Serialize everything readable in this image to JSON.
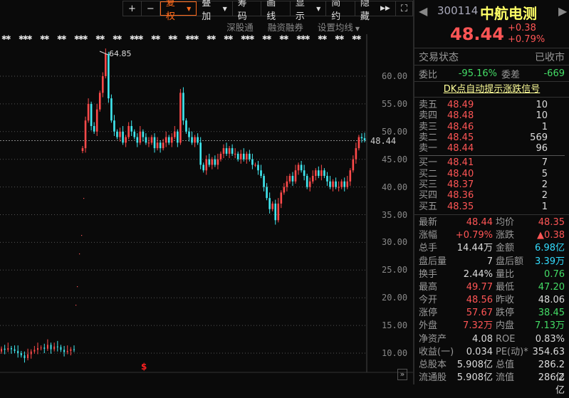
{
  "toolbar": {
    "plus": "+",
    "minus": "−",
    "fuquan": "复权",
    "diejia": "叠加",
    "chouma": "筹码",
    "huaxian": "画线",
    "xianshi": "显示",
    "jianyue": "简约",
    "yincang": "隐藏",
    "fullscreen": "⛶"
  },
  "subbar": [
    "深股通",
    "融资融券",
    "设置均线"
  ],
  "axis": [
    "60.00",
    "55.00",
    "50.00",
    "45.00",
    "40.00",
    "35.00",
    "30.00",
    "25.00",
    "20.00",
    "15.00",
    "10.00"
  ],
  "current_price_tag": "48.44",
  "peak_label": "64.85",
  "colors": {
    "up": "#ff4a4a",
    "down": "#40e8f0",
    "accent": "#ff6a1a"
  },
  "chart_data": {
    "type": "candlestick",
    "ylim": [
      10,
      60
    ],
    "closes": [
      47,
      52,
      55,
      51,
      50,
      54,
      57,
      60,
      64,
      56,
      52,
      50,
      49,
      50,
      48,
      49,
      51,
      50,
      49,
      48,
      50,
      49,
      48,
      48,
      49,
      47,
      48,
      47,
      48,
      49,
      48,
      49,
      50,
      48,
      57,
      52,
      50,
      49,
      48,
      49,
      48,
      44,
      43,
      45,
      44,
      45,
      44,
      45,
      46,
      47,
      46,
      47,
      46,
      46,
      45,
      46,
      45,
      46,
      45,
      44,
      44,
      43,
      42,
      40,
      38,
      36,
      37,
      34,
      37,
      39,
      40,
      41,
      42,
      41,
      43,
      44,
      43,
      42,
      40,
      41,
      42,
      43,
      42,
      43,
      42,
      41,
      40,
      41,
      40,
      40,
      41,
      40,
      41,
      43,
      45,
      47,
      49,
      48.8,
      48.44
    ],
    "early_closes": [
      10.8,
      10.6,
      10.9,
      10.7,
      10.4,
      10.0,
      9.6,
      9.1,
      9.8,
      10.3,
      10.6,
      10.9,
      11.0,
      10.8,
      11.5,
      10.7,
      11.2,
      11.1,
      10.6,
      10.2,
      10.4,
      10.7,
      10.6
    ]
  },
  "quote": {
    "code": "300114",
    "name": "中航电测",
    "price": "48.44",
    "change": "+0.38",
    "change_pct": "+0.79%"
  },
  "status": {
    "label": "交易状态",
    "value": "已收市"
  },
  "weibi": {
    "label": "委比",
    "value": "-95.16%",
    "diff_label": "委差",
    "diff": "-669"
  },
  "signal_link": "DK点自动提示涨跌信号",
  "sell": [
    {
      "l": "卖五",
      "p": "48.49",
      "v": "10"
    },
    {
      "l": "卖四",
      "p": "48.48",
      "v": "10"
    },
    {
      "l": "卖三",
      "p": "48.46",
      "v": "1"
    },
    {
      "l": "卖二",
      "p": "48.45",
      "v": "569"
    },
    {
      "l": "卖一",
      "p": "48.44",
      "v": "96"
    }
  ],
  "buy": [
    {
      "l": "买一",
      "p": "48.41",
      "v": "7"
    },
    {
      "l": "买二",
      "p": "48.40",
      "v": "5"
    },
    {
      "l": "买三",
      "p": "48.37",
      "v": "2"
    },
    {
      "l": "买四",
      "p": "48.36",
      "v": "2"
    },
    {
      "l": "买五",
      "p": "48.35",
      "v": "1"
    }
  ],
  "stats": [
    {
      "a": "最新",
      "av": "48.44",
      "ac": "red",
      "b": "均价",
      "bv": "48.35",
      "bc": "red"
    },
    {
      "a": "涨幅",
      "av": "+0.79%",
      "ac": "red",
      "b": "涨跌",
      "bv": "▲0.38",
      "bc": "red"
    },
    {
      "a": "总手",
      "av": "14.44万",
      "ac": "wht",
      "b": "金额",
      "bv": "6.98亿",
      "bc": "cyan"
    },
    {
      "a": "盘后量",
      "av": "7",
      "ac": "wht",
      "b": "盘后额",
      "bv": "3.39万",
      "bc": "cyan"
    },
    {
      "a": "换手",
      "av": "2.44%",
      "ac": "wht",
      "b": "量比",
      "bv": "0.76",
      "bc": "grn"
    },
    {
      "a": "最高",
      "av": "49.77",
      "ac": "red",
      "b": "最低",
      "bv": "47.20",
      "bc": "grn"
    },
    {
      "a": "今开",
      "av": "48.56",
      "ac": "red",
      "b": "昨收",
      "bv": "48.06",
      "bc": "wht"
    },
    {
      "a": "涨停",
      "av": "57.67",
      "ac": "red",
      "b": "跌停",
      "bv": "38.45",
      "bc": "grn"
    },
    {
      "a": "外盘",
      "av": "7.32万",
      "ac": "red",
      "b": "内盘",
      "bv": "7.13万",
      "bc": "grn"
    },
    {
      "a": "净资产",
      "av": "4.08",
      "ac": "wht",
      "b": "ROE",
      "bv": "0.83%",
      "bc": "wht"
    },
    {
      "a": "收益(一)",
      "av": "0.034",
      "ac": "wht",
      "b": "PE(动)*",
      "bv": "354.63",
      "bc": "wht"
    },
    {
      "a": "总股本",
      "av": "5.908亿",
      "ac": "wht",
      "b": "总值",
      "bv": "286.2亿",
      "bc": "wht"
    },
    {
      "a": "流通股",
      "av": "5.908亿",
      "ac": "wht",
      "b": "流值",
      "bv": "286.2亿",
      "bc": "wht"
    }
  ]
}
